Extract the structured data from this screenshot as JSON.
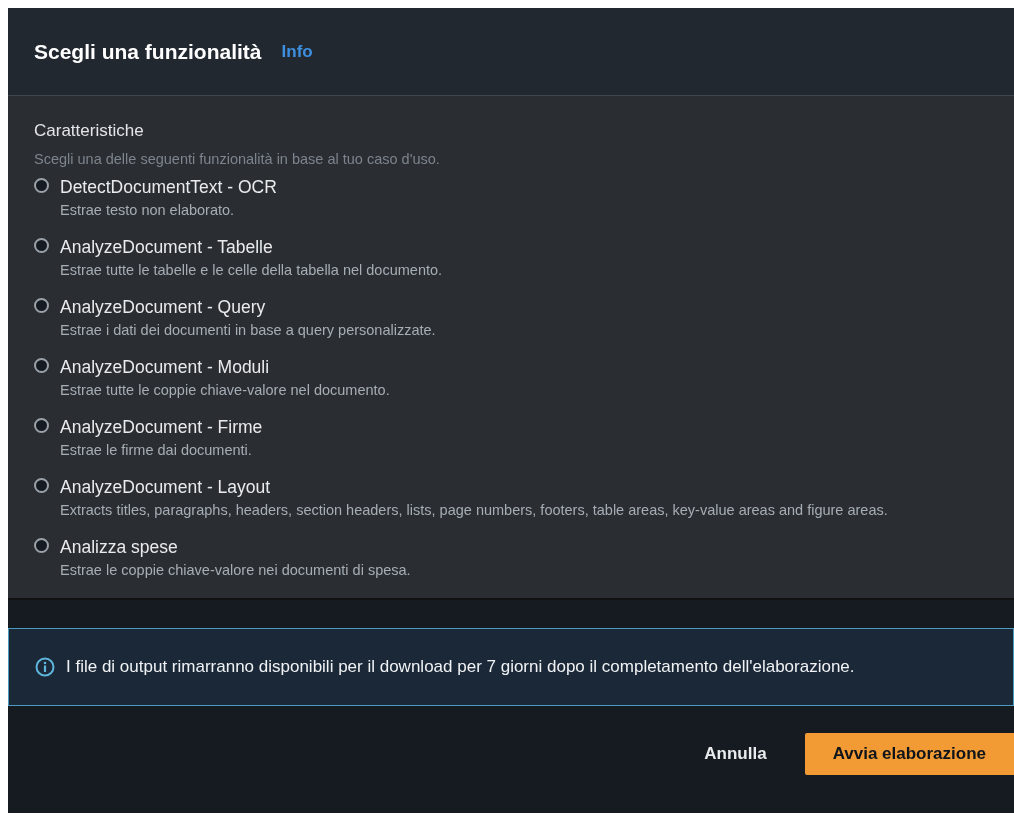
{
  "header": {
    "title": "Scegli una funzionalità",
    "info_link": "Info"
  },
  "features": {
    "label": "Caratteristiche",
    "description": "Scegli una delle seguenti funzionalità in base al tuo caso d'uso.",
    "options": [
      {
        "label": "DetectDocumentText - OCR",
        "description": "Estrae testo non elaborato.",
        "selected": false
      },
      {
        "label": "AnalyzeDocument - Tabelle",
        "description": "Estrae tutte le tabelle e le celle della tabella nel documento.",
        "selected": false
      },
      {
        "label": "AnalyzeDocument - Query",
        "description": "Estrae i dati dei documenti in base a query personalizzate.",
        "selected": false
      },
      {
        "label": "AnalyzeDocument - Moduli",
        "description": "Estrae tutte le coppie chiave-valore nel documento.",
        "selected": false
      },
      {
        "label": "AnalyzeDocument - Firme",
        "description": "Estrae le firme dai documenti.",
        "selected": false
      },
      {
        "label": "AnalyzeDocument - Layout",
        "description": "Extracts titles, paragraphs, headers, section headers, lists, page numbers, footers, table areas, key-value areas and figure areas.",
        "selected": false
      },
      {
        "label": "Analizza spese",
        "description": "Estrae le coppie chiave-valore nei documenti di spesa.",
        "selected": false
      }
    ]
  },
  "info_alert": {
    "text": "I file di output rimarranno disponibili per il download per 7 giorni dopo il completamento dell'elaborazione."
  },
  "buttons": [
    {
      "label": "Annulla",
      "kind": "link"
    },
    {
      "label": "Avvia elaborazione",
      "kind": "primary"
    }
  ]
}
